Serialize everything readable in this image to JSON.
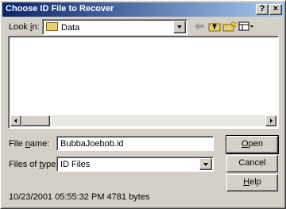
{
  "window": {
    "title": "Choose ID File to Recover",
    "help_button": "?",
    "close_button": "×"
  },
  "look_in": {
    "label_pre": "Look ",
    "label_u": "i",
    "label_post": "n:",
    "value": "Data"
  },
  "file_name": {
    "label_pre": "File ",
    "label_u": "n",
    "label_post": "ame:",
    "value": "BubbaJoebob.id"
  },
  "files_of_type": {
    "label_pre": "Files of ",
    "label_u": "t",
    "label_post": "ype:",
    "value": "ID Files"
  },
  "buttons": {
    "open": {
      "u": "O",
      "rest": "pen"
    },
    "cancel": "Cancel",
    "help": {
      "u": "H",
      "rest": "elp"
    }
  },
  "status": "10/23/2001 05:55:32 PM 4781 bytes",
  "toolbar_icons": [
    "back-arrow-icon",
    "up-one-level-icon",
    "new-folder-icon",
    "view-menu-icon"
  ]
}
